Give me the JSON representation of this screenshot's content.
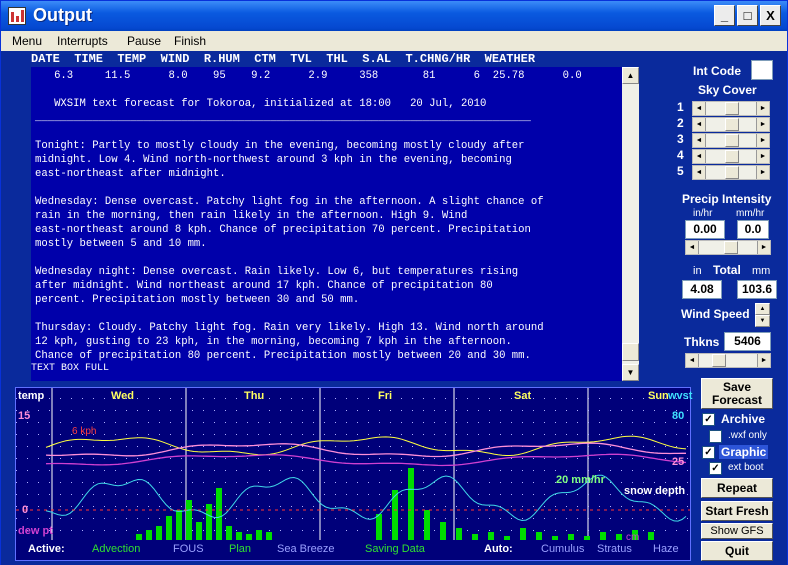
{
  "window": {
    "title": "Output",
    "controls": [
      "_",
      "□",
      "X"
    ]
  },
  "menu": {
    "items": [
      {
        "label": "Menu",
        "key": "M"
      },
      {
        "label": "Interrupts",
        "key": "I"
      },
      {
        "label": "Pause",
        "key": "P"
      },
      {
        "label": "Finish",
        "key": "F"
      }
    ]
  },
  "table": {
    "header": "DATE  TIME  TEMP  WIND  R.HUM  CTM  TVL  THL  S.AL  T.CHNG/HR  WEATHER"
  },
  "forecast_text": "   6.3     11.5      8.0    95    9.2      2.9     358       81      6  25.78      0.0\n\n   WXSIM text forecast for Tokoroa, initialized at 18:00   20 Jul, 2010\n______________________________________________________________________________\n\nTonight: Partly to mostly cloudy in the evening, becoming mostly cloudy after\nmidnight. Low 4. Wind north-northwest around 3 kph in the evening, becoming\neast-northeast after midnight.\n\nWednesday: Dense overcast. Patchy light fog in the afternoon. A slight chance of\nrain in the morning, then rain likely in the afternoon. High 9. Wind\neast-northeast around 8 kph. Chance of precipitation 70 percent. Precipitation\nmostly between 5 and 10 mm.\n\nWednesday night: Dense overcast. Rain likely. Low 6, but temperatures rising\nafter midnight. Wind northeast around 17 kph. Chance of precipitation 80\npercent. Precipitation mostly between 30 and 50 mm.\n\nThursday: Cloudy. Patchy light fog. Rain very likely. High 13. Wind north around\n12 kph, gusting to 23 kph, in the morning, becoming 7 kph in the afternoon.\nChance of precipitation 80 percent. Precipitation mostly between 20 and 30 mm.",
  "text_box_status": "TEXT BOX FULL",
  "right_panel": {
    "int_code_label": "Int Code",
    "int_code_value": "",
    "sky_cover_label": "Sky Cover",
    "sky_rows": [
      "1",
      "2",
      "3",
      "4",
      "5"
    ],
    "precip_label": "Precip Intensity",
    "in_hr_label": "in/hr",
    "mm_hr_label": "mm/hr",
    "in_hr_value": "0.00",
    "mm_hr_value": "0.0",
    "in_label": "in",
    "total_label": "Total",
    "mm_label": "mm",
    "total_in_value": "4.08",
    "total_mm_value": "103.6",
    "wind_speed_label": "Wind Speed",
    "thkns_label": "Thkns",
    "thkns_value": "5406",
    "save_forecast_label": "Save\nForecast",
    "archive_label": "Archive",
    "wxf_only_label": ".wxf only",
    "graphic_label": "Graphic",
    "ext_boot_label": "ext boot",
    "repeat_label": "Repeat",
    "start_fresh_label": "Start Fresh",
    "show_gfs_label": "Show GFS",
    "quit_label": "Quit"
  },
  "graph": {
    "temp_label": "temp",
    "days": [
      "Wed",
      "Thu",
      "Fri",
      "Sat",
      "Sun"
    ],
    "y_15": "15",
    "y_0": "0",
    "kph_label": "6 kph",
    "dewpt_label": "dew pt",
    "snow_depth_label": "snow depth",
    "mm_label": "20 mm/hr",
    "right_top_label": "wvst",
    "right_val_top": "80",
    "right_val_mid": "25",
    "right_bottom_label": "cm",
    "active_label": "Active:",
    "active_items": [
      "Advection",
      "FOUS",
      "Plan",
      "Sea Breeze",
      "Saving Data"
    ],
    "auto_label": "Auto:",
    "auto_items": [
      "Cumulus",
      "Stratus",
      "Haze"
    ],
    "colors": {
      "temp": "#ff8fd8",
      "dew": "#d040d0",
      "clouds": "#ffff40",
      "wind": "#40d8e8",
      "precip": "#00dd00",
      "grid": "#b0b0ff"
    }
  }
}
